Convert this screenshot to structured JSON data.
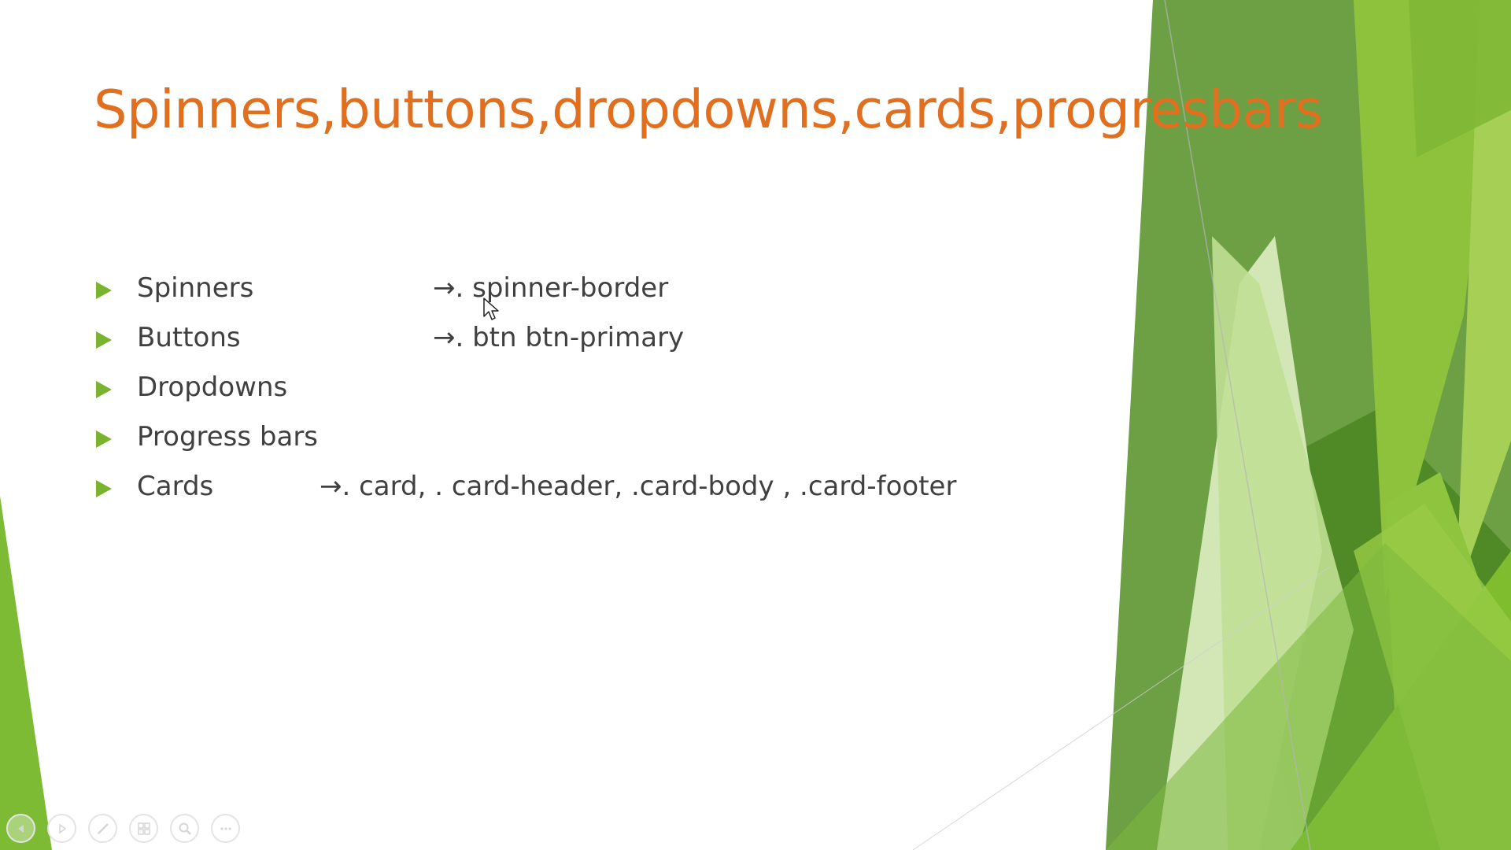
{
  "slide": {
    "title": "Spinners,buttons,dropdowns,cards,progresbars",
    "bullets": [
      {
        "label": "Spinners",
        "detail": "→. spinner-border"
      },
      {
        "label": "Buttons",
        "detail": "→. btn btn-primary"
      },
      {
        "label": "Dropdowns",
        "detail": ""
      },
      {
        "label": "Progress bars",
        "detail": ""
      },
      {
        "label": "Cards",
        "detail": "→. card, . card-header, .card-body  , .card-footer"
      }
    ]
  },
  "toolbar": {
    "icons": [
      "previous-icon",
      "next-icon",
      "pen-icon",
      "slides-grid-icon",
      "zoom-icon",
      "more-icon"
    ]
  },
  "colors": {
    "title": "#e06f20",
    "bullet_marker": "#7ab32e",
    "body_text": "#404040",
    "green_light": "#c5e29a",
    "green_mid": "#8cc63f",
    "green_dark": "#5b8f35"
  }
}
